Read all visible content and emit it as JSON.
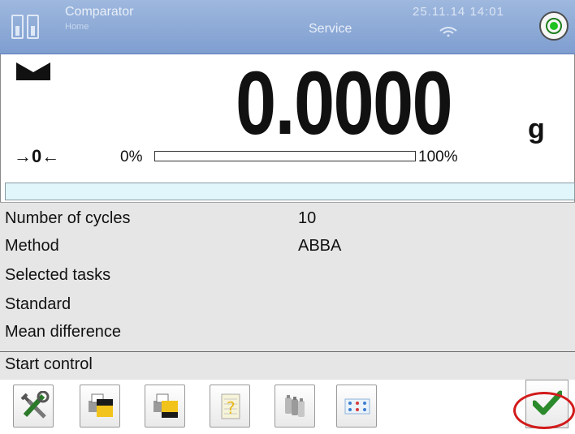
{
  "header": {
    "app_title": "Comparator",
    "app_subtitle": "Home",
    "user": "Service",
    "datetime": "25.11.14 14:01"
  },
  "display": {
    "reading": "0.0000",
    "unit": "g",
    "zero_indicator": "→0←",
    "bar_min": "0%",
    "bar_max": "100%",
    "bar_fill_fraction": 0.0
  },
  "info_bar": "",
  "parameters": [
    {
      "label": "Number of cycles",
      "value": "10"
    },
    {
      "label": "Method",
      "value": "ABBA"
    },
    {
      "label": "Selected tasks",
      "value": ""
    },
    {
      "label": "Standard",
      "value": ""
    },
    {
      "label": "Mean difference",
      "value": ""
    }
  ],
  "start_control": "Start control",
  "toolbar": {
    "buttons": [
      "setup-icon",
      "printer-header-icon",
      "printer-footer-icon",
      "database-icon",
      "weights-icon",
      "comparator-matrix-icon"
    ],
    "confirm": "confirm-checkmark-icon",
    "highlight_color": "#d21b1b"
  }
}
